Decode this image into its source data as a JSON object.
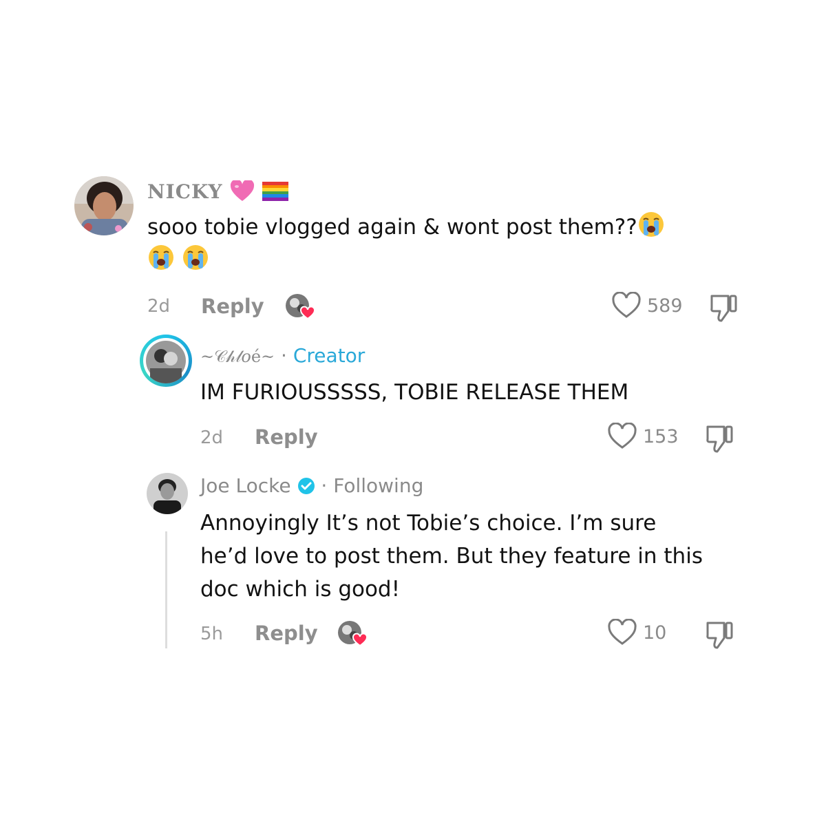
{
  "comments": [
    {
      "username": "NICKY",
      "text_line1": "sooo tobie vlogged again & wont post them??",
      "time": "2d",
      "reply_label": "Reply",
      "likes": "589",
      "icons": [
        "pink-heart-emoji",
        "rainbow-flag-emoji",
        "loudly-crying-emoji",
        "liked-by-creator-heart",
        "like-heart-icon",
        "dislike-thumb-icon"
      ]
    },
    {
      "username": "~𝒞𝒽𝓁𝑜é~",
      "separator": "·",
      "badge": "Creator",
      "text": "IM FURIOUSSSSS, TOBIE RELEASE THEM",
      "time": "2d",
      "reply_label": "Reply",
      "likes": "153",
      "accent_color": "#29a8d8"
    },
    {
      "username": "Joe Locke",
      "separator": "·",
      "badge": "Following",
      "text_lines": [
        "Annoyingly It’s not Tobie’s choice. I’m sure",
        "he’d love to post them. But they feature in this",
        "doc which is good!"
      ],
      "time": "5h",
      "reply_label": "Reply",
      "likes": "10",
      "verified_color": "#20c3e8"
    }
  ]
}
